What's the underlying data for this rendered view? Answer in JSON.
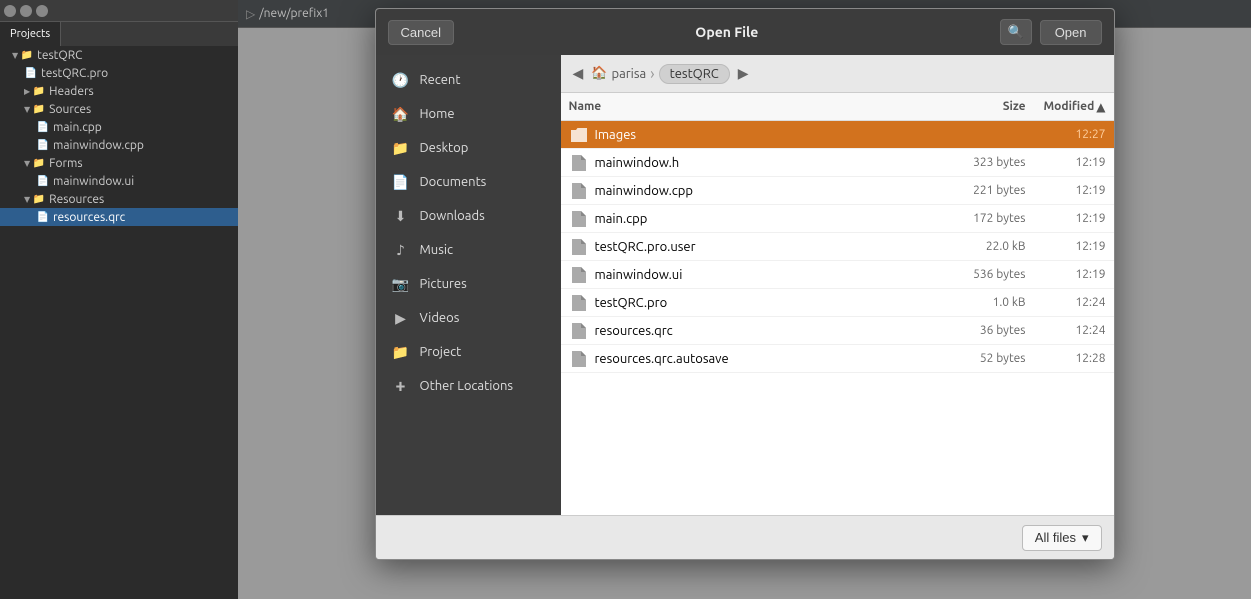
{
  "ide": {
    "tab_label": "Projects",
    "path_bar": "/new/prefix1",
    "path_prefix": "▷",
    "file_active": "resources.qrc",
    "tree": [
      {
        "label": "testQRC",
        "level": 0,
        "type": "project",
        "expanded": true
      },
      {
        "label": "testQRC.pro",
        "level": 1,
        "type": "pro"
      },
      {
        "label": "Headers",
        "level": 1,
        "type": "folder"
      },
      {
        "label": "Sources",
        "level": 1,
        "type": "folder",
        "expanded": true
      },
      {
        "label": "main.cpp",
        "level": 2,
        "type": "cpp"
      },
      {
        "label": "mainwindow.cpp",
        "level": 2,
        "type": "cpp"
      },
      {
        "label": "Forms",
        "level": 1,
        "type": "folder",
        "expanded": true
      },
      {
        "label": "mainwindow.ui",
        "level": 2,
        "type": "ui"
      },
      {
        "label": "Resources",
        "level": 1,
        "type": "folder",
        "expanded": true
      },
      {
        "label": "resources.qrc",
        "level": 2,
        "type": "qrc",
        "selected": true
      }
    ]
  },
  "dialog": {
    "title": "Open File",
    "cancel_label": "Cancel",
    "open_label": "Open",
    "nav_items": [
      {
        "id": "recent",
        "label": "Recent",
        "icon": "🕐"
      },
      {
        "id": "home",
        "label": "Home",
        "icon": "🏠"
      },
      {
        "id": "desktop",
        "label": "Desktop",
        "icon": "📁"
      },
      {
        "id": "documents",
        "label": "Documents",
        "icon": "📄"
      },
      {
        "id": "downloads",
        "label": "Downloads",
        "icon": "⬇"
      },
      {
        "id": "music",
        "label": "Music",
        "icon": "♪"
      },
      {
        "id": "pictures",
        "label": "Pictures",
        "icon": "📷"
      },
      {
        "id": "videos",
        "label": "Videos",
        "icon": "▶"
      },
      {
        "id": "project",
        "label": "Project",
        "icon": "📁"
      },
      {
        "id": "other",
        "label": "Other Locations",
        "icon": "+"
      }
    ],
    "breadcrumb": {
      "back_arrow": "◀",
      "home_icon": "🏠",
      "home_label": "parisa",
      "current": "testQRC",
      "forward_arrow": "▶"
    },
    "columns": {
      "name": "Name",
      "size": "Size",
      "modified": "Modified",
      "sort_arrow": "▲"
    },
    "files": [
      {
        "name": "Images",
        "size": "",
        "modified": "12:27",
        "type": "folder",
        "selected": true
      },
      {
        "name": "mainwindow.h",
        "size": "323 bytes",
        "modified": "12:19",
        "type": "file",
        "selected": false
      },
      {
        "name": "mainwindow.cpp",
        "size": "221 bytes",
        "modified": "12:19",
        "type": "file",
        "selected": false
      },
      {
        "name": "main.cpp",
        "size": "172 bytes",
        "modified": "12:19",
        "type": "file",
        "selected": false
      },
      {
        "name": "testQRC.pro.user",
        "size": "22.0 kB",
        "modified": "12:19",
        "type": "file",
        "selected": false
      },
      {
        "name": "mainwindow.ui",
        "size": "536 bytes",
        "modified": "12:19",
        "type": "file",
        "selected": false
      },
      {
        "name": "testQRC.pro",
        "size": "1.0 kB",
        "modified": "12:24",
        "type": "file",
        "selected": false
      },
      {
        "name": "resources.qrc",
        "size": "36 bytes",
        "modified": "12:24",
        "type": "file",
        "selected": false
      },
      {
        "name": "resources.qrc.autosave",
        "size": "52 bytes",
        "modified": "12:28",
        "type": "file",
        "selected": false
      }
    ],
    "filter": {
      "label": "All files",
      "arrow": "▾"
    }
  }
}
